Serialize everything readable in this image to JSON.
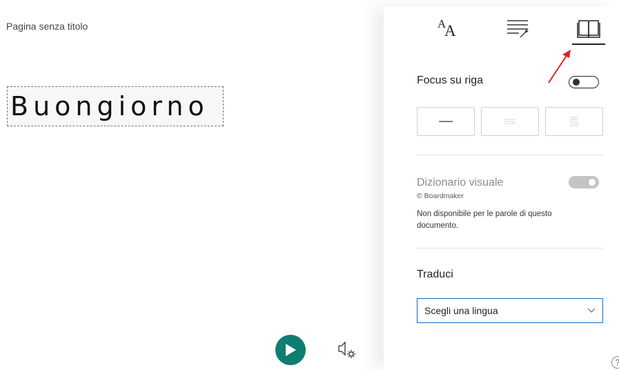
{
  "document": {
    "title": "Pagina senza titolo",
    "word": "Buongiorno"
  },
  "playback": {
    "play_icon": "play-icon",
    "voice_settings_icon": "voice-settings-icon"
  },
  "panel": {
    "tabs": [
      {
        "name": "text-preferences",
        "icon": "text-size-icon",
        "glyph": "A"
      },
      {
        "name": "grammar-options",
        "icon": "grammar-options-icon"
      },
      {
        "name": "reading-preferences",
        "icon": "book-icon",
        "active": true
      }
    ],
    "line_focus": {
      "label": "Focus su riga",
      "enabled": false,
      "options": [
        "1 riga",
        "3 righe",
        "5 righe"
      ]
    },
    "picture_dictionary": {
      "label": "Dizionario visuale",
      "credit": "© Boardmaker",
      "note": "Non disponibile per le parole di questo documento.",
      "enabled": true,
      "disabled": true
    },
    "translate": {
      "label": "Traduci",
      "select_value": "Scegli una lingua"
    }
  },
  "colors": {
    "accent": "#0f7d70",
    "arrow": "#e02020",
    "select_border": "#0f6cbd"
  }
}
